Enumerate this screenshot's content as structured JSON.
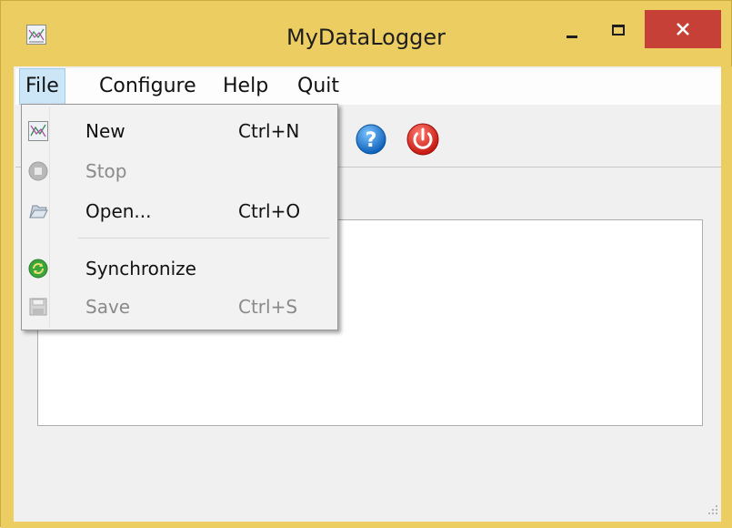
{
  "window": {
    "title": "MyDataLogger"
  },
  "menubar": {
    "items": [
      {
        "label": "File"
      },
      {
        "label": "Configure"
      },
      {
        "label": "Help"
      },
      {
        "label": "Quit"
      }
    ]
  },
  "file_menu": {
    "items": [
      {
        "label": "New",
        "shortcut": "Ctrl+N",
        "enabled": true,
        "icon": "chart-icon"
      },
      {
        "label": "Stop",
        "shortcut": "",
        "enabled": false,
        "icon": "stop-icon"
      },
      {
        "label": "Open...",
        "shortcut": "Ctrl+O",
        "enabled": true,
        "icon": "folder-open-icon"
      },
      {
        "label": "Synchronize",
        "shortcut": "",
        "enabled": true,
        "icon": "sync-icon"
      },
      {
        "label": "Save",
        "shortcut": "Ctrl+S",
        "enabled": false,
        "icon": "save-icon"
      }
    ]
  },
  "toolbar": {
    "buttons": [
      {
        "icon": "help-icon"
      },
      {
        "icon": "power-icon"
      }
    ]
  },
  "colors": {
    "title_bar": "#eccd62",
    "close_button": "#c74038",
    "menu_highlight": "#cde6f7"
  }
}
